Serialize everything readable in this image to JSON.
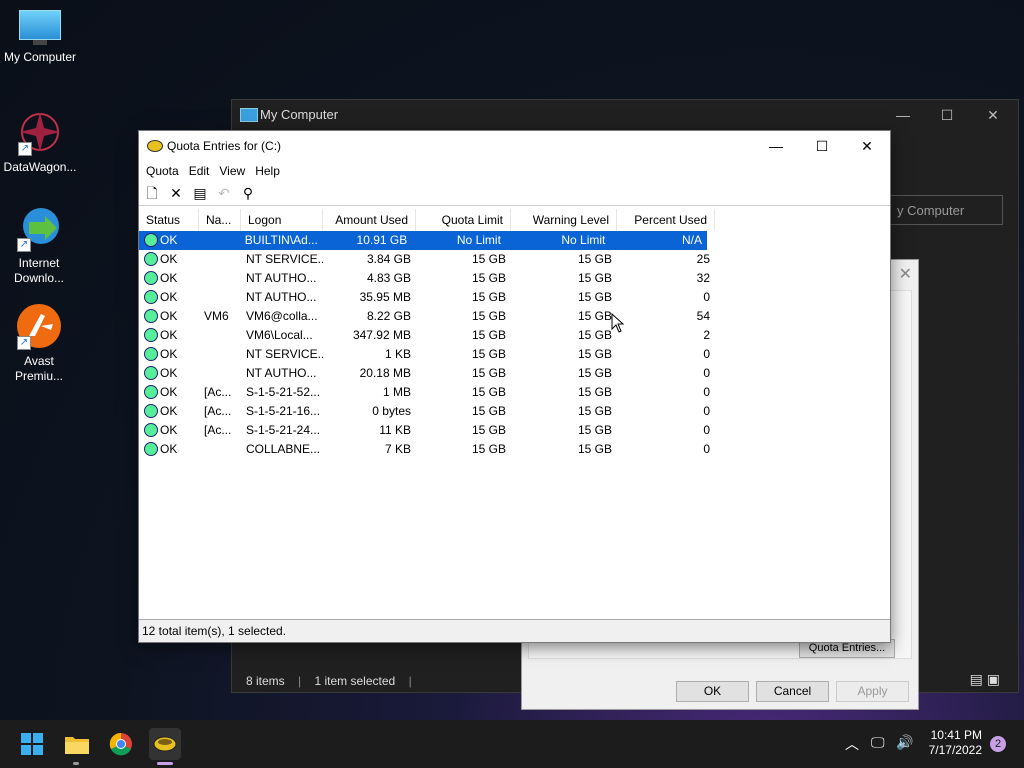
{
  "desktop": {
    "icons": [
      {
        "label": "My Computer"
      },
      {
        "label": "DataWagon..."
      },
      {
        "label": "Internet Downlo..."
      },
      {
        "label": "Avast Premiu..."
      }
    ]
  },
  "bg_window": {
    "title": "My Computer",
    "address_text": "y Computer",
    "status_items": "8 items",
    "status_selected": "1 item selected"
  },
  "props_dialog": {
    "quota_entries_btn": "Quota Entries...",
    "ok": "OK",
    "cancel": "Cancel",
    "apply": "Apply"
  },
  "quota_window": {
    "title": "Quota Entries for  (C:)",
    "menu": [
      "Quota",
      "Edit",
      "View",
      "Help"
    ],
    "columns": [
      "Status",
      "Na...",
      "Logon Name",
      "Amount Used",
      "Quota Limit",
      "Warning Level",
      "Percent Used"
    ],
    "rows": [
      [
        "OK",
        "",
        "BUILTIN\\Ad...",
        "10.91 GB",
        "No Limit",
        "No Limit",
        "N/A"
      ],
      [
        "OK",
        "",
        "NT SERVICE...",
        "3.84 GB",
        "15 GB",
        "15 GB",
        "25"
      ],
      [
        "OK",
        "",
        "NT AUTHO...",
        "4.83 GB",
        "15 GB",
        "15 GB",
        "32"
      ],
      [
        "OK",
        "",
        "NT AUTHO...",
        "35.95 MB",
        "15 GB",
        "15 GB",
        "0"
      ],
      [
        "OK",
        "VM6",
        "VM6@colla...",
        "8.22 GB",
        "15 GB",
        "15 GB",
        "54"
      ],
      [
        "OK",
        "",
        "VM6\\Local...",
        "347.92 MB",
        "15 GB",
        "15 GB",
        "2"
      ],
      [
        "OK",
        "",
        "NT SERVICE...",
        "1 KB",
        "15 GB",
        "15 GB",
        "0"
      ],
      [
        "OK",
        "",
        "NT AUTHO...",
        "20.18 MB",
        "15 GB",
        "15 GB",
        "0"
      ],
      [
        "OK",
        "[Ac...",
        "S-1-5-21-52...",
        "1 MB",
        "15 GB",
        "15 GB",
        "0"
      ],
      [
        "OK",
        "[Ac...",
        "S-1-5-21-16...",
        "0 bytes",
        "15 GB",
        "15 GB",
        "0"
      ],
      [
        "OK",
        "[Ac...",
        "S-1-5-21-24...",
        "11 KB",
        "15 GB",
        "15 GB",
        "0"
      ],
      [
        "OK",
        "",
        "COLLABNE...",
        "7 KB",
        "15 GB",
        "15 GB",
        "0"
      ]
    ],
    "selected_row": 0,
    "status": "12 total item(s), 1 selected."
  },
  "taskbar": {
    "time": "10:41 PM",
    "date": "7/17/2022",
    "notifications": "2"
  }
}
